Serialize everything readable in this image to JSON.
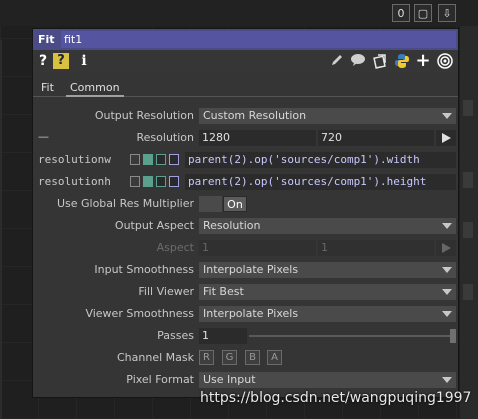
{
  "window_buttons": [
    {
      "name": "zero-icon",
      "glyph": "0"
    },
    {
      "name": "maximize-icon",
      "glyph": "▢"
    },
    {
      "name": "arrow-down-icon",
      "glyph": "⇩"
    }
  ],
  "panel": {
    "op_type": "Fit",
    "op_name": "fit1",
    "help_glyph": "?",
    "python_help_glyph": "?",
    "info_glyph": "i",
    "icons": [
      "pencil-icon",
      "comment-icon",
      "clone-icon",
      "python-icon",
      "plus-icon",
      "viewer-icon"
    ],
    "tabs": [
      {
        "label": "Fit",
        "active": false
      },
      {
        "label": "Common",
        "active": true
      }
    ],
    "params": {
      "output_resolution": {
        "label": "Output Resolution",
        "value": "Custom Resolution"
      },
      "resolution": {
        "prefix": "—",
        "label": "Resolution",
        "w": "1280",
        "h": "720"
      },
      "resolutionw": {
        "label": "resolutionw",
        "expr": "parent(2).op('sources/comp1').width"
      },
      "resolutionh": {
        "label": "resolutionh",
        "expr": "parent(2).op('sources/comp1').height"
      },
      "global_res": {
        "label": "Use Global Res Multiplier",
        "value": "On"
      },
      "output_aspect": {
        "label": "Output Aspect",
        "value": "Resolution"
      },
      "aspect": {
        "label": "Aspect",
        "a": "1",
        "b": "1"
      },
      "input_smoothness": {
        "label": "Input Smoothness",
        "value": "Interpolate Pixels"
      },
      "fill_viewer": {
        "label": "Fill Viewer",
        "value": "Fit Best"
      },
      "viewer_smoothness": {
        "label": "Viewer Smoothness",
        "value": "Interpolate Pixels"
      },
      "passes": {
        "label": "Passes",
        "value": "1"
      },
      "channel_mask": {
        "label": "Channel Mask",
        "channels": [
          "R",
          "G",
          "B",
          "A"
        ]
      },
      "pixel_format": {
        "label": "Pixel Format",
        "value": "Use Input"
      }
    }
  },
  "watermark": "https://blog.csdn.net/wangpuqing1997",
  "colors": {
    "title_bar": "#4b4b88",
    "panel_bg": "#353535",
    "mode_green": "#5aa08c",
    "mode_purple": "#a0a0e0",
    "expr_text": "#c8c8ff"
  }
}
